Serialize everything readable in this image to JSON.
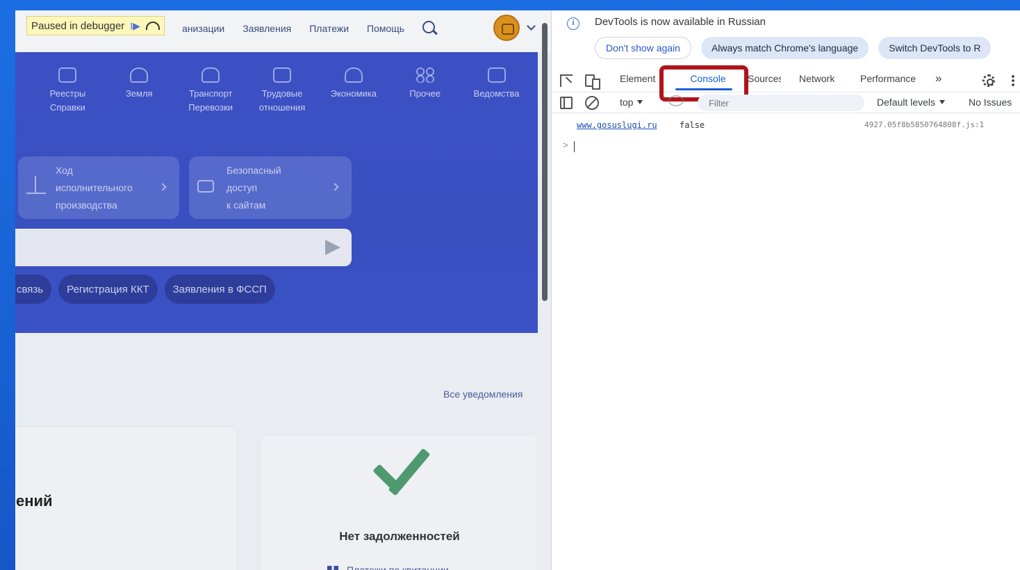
{
  "site": {
    "debug": {
      "label": "Paused in debugger",
      "resume_glyph": "I▶"
    },
    "nav": [
      "анизации",
      "Заявления",
      "Платежи",
      "Помощь"
    ],
    "categories": [
      {
        "label": "Реестры\nСправки"
      },
      {
        "label": "Земля"
      },
      {
        "label": "Транспорт\nПеревозки"
      },
      {
        "label": "Трудовые\nотношения"
      },
      {
        "label": "Экономика"
      },
      {
        "label": "Прочее"
      },
      {
        "label": "Ведомства"
      }
    ],
    "tiles": [
      {
        "text": "Ход\nисполнительного\nпроизводства"
      },
      {
        "text": "Безопасный\nдоступ\nк сайтам"
      }
    ],
    "chips": [
      "связь",
      "Регистрация ККТ",
      "Заявления в ФССП"
    ],
    "notifications_link": "Все уведомления",
    "card_title_partial": "ений",
    "no_debt": "Нет задолженностей",
    "pay_link": "Платежи по квитанции"
  },
  "devtools": {
    "info_text": "DevTools is now available in Russian",
    "buttons": [
      "Don't show again",
      "Always match Chrome's language",
      "Switch DevTools to R"
    ],
    "tabs": {
      "elements": "Elements",
      "console": "Console",
      "sources": "Sources",
      "network": "Network",
      "performance": "Performance",
      "more": "»"
    },
    "toolbar": {
      "context": "top",
      "filter_placeholder": "Filter",
      "levels": "Default levels",
      "issues": "No Issues"
    },
    "console": {
      "link": "www.gosuslugi.ru",
      "value": "false",
      "source": "4927.05f8b5850764808f.js:1",
      "prompt": ">"
    }
  }
}
